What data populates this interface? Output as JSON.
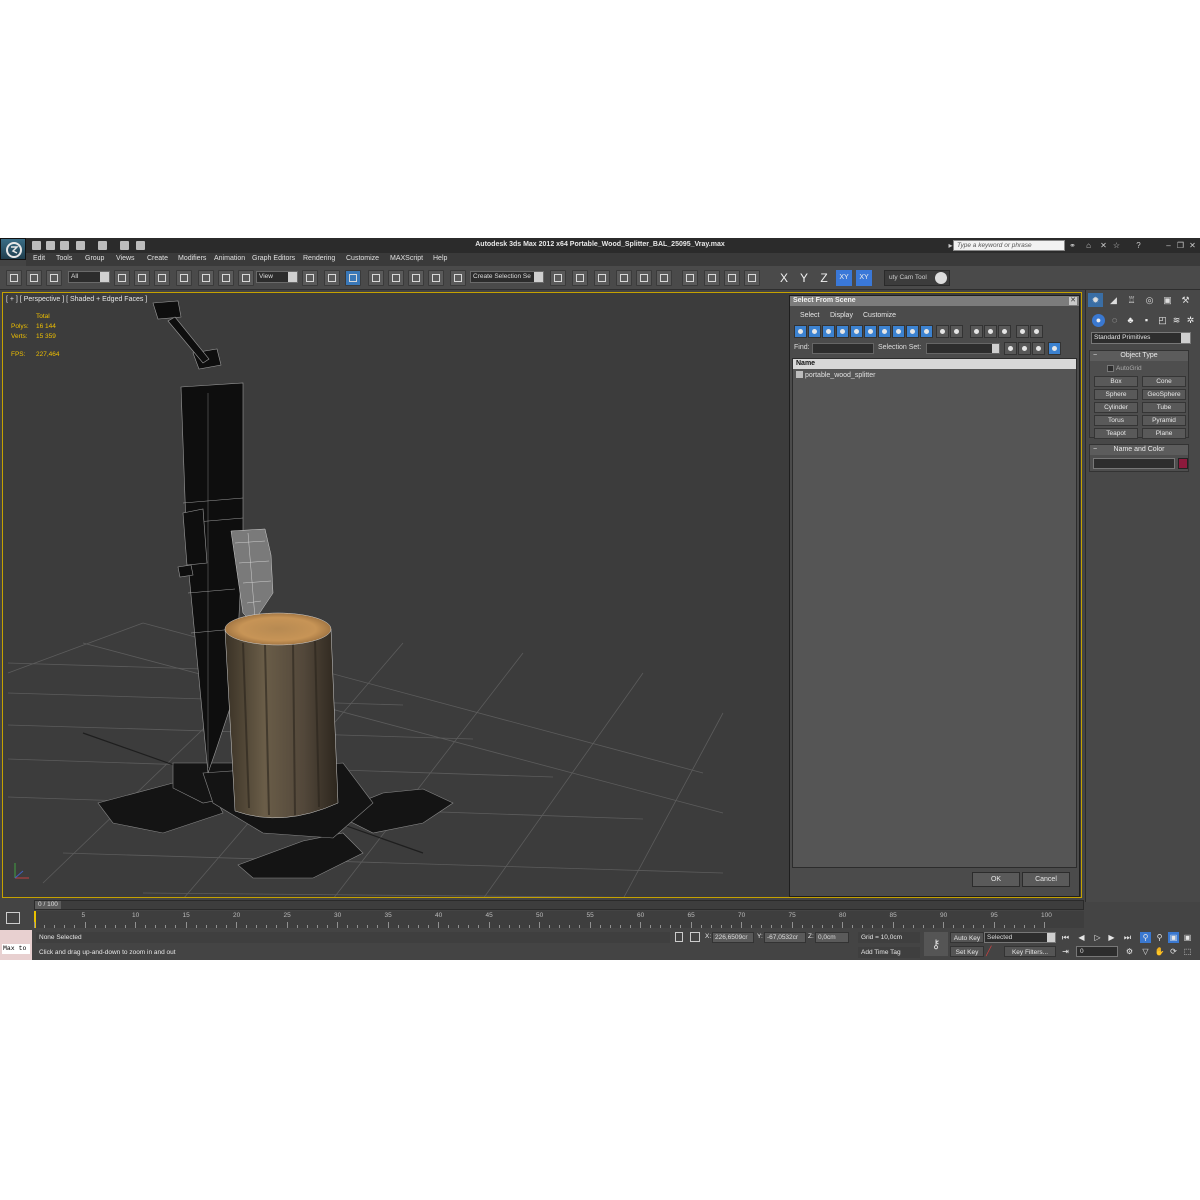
{
  "window": {
    "title": "Autodesk 3ds Max  2012 x64     Portable_Wood_Splitter_BAL_25095_Vray.max",
    "search_placeholder": "Type a keyword or phrase"
  },
  "menu": [
    "Edit",
    "Tools",
    "Group",
    "Views",
    "Create",
    "Modifiers",
    "Animation",
    "Graph Editors",
    "Rendering",
    "Customize",
    "MAXScript",
    "Help"
  ],
  "toolbar": {
    "filter_dropdown": "All",
    "refcoord_dropdown": "View",
    "selection_set_dropdown": "Create Selection Se",
    "axis_x": "X",
    "axis_y": "Y",
    "axis_z": "Z",
    "axis_xy": "XY",
    "axis_xy2": "XY",
    "cam_tool_label": "uty Cam Tool"
  },
  "viewport": {
    "label": "[ + ] [ Perspective ] [ Shaded + Edged Faces ]",
    "stats": {
      "total_label": "Total",
      "polys_label": "Polys:",
      "polys_value": "16 144",
      "verts_label": "Verts:",
      "verts_value": "15 359",
      "fps_label": "FPS:",
      "fps_value": "227,464"
    }
  },
  "select_dialog": {
    "title": "Select From Scene",
    "menus": [
      "Select",
      "Display",
      "Customize"
    ],
    "find_label": "Find:",
    "selection_set_label": "Selection Set:",
    "column_name": "Name",
    "items": [
      "portable_wood_splitter"
    ],
    "ok_label": "OK",
    "cancel_label": "Cancel"
  },
  "command_panel": {
    "category": "Standard Primitives",
    "object_type_title": "Object Type",
    "autogrid_label": "AutoGrid",
    "primitives": [
      "Box",
      "Cone",
      "Sphere",
      "GeoSphere",
      "Cylinder",
      "Tube",
      "Torus",
      "Pyramid",
      "Teapot",
      "Plane"
    ],
    "name_color_title": "Name and Color",
    "swatch_color": "#8c1a3c"
  },
  "timeline": {
    "frame_display": "0 / 100",
    "ticks": [
      "5",
      "10",
      "15",
      "20",
      "25",
      "30",
      "35",
      "40",
      "45",
      "50",
      "55",
      "60",
      "65",
      "70",
      "75",
      "80",
      "85",
      "90",
      "95",
      "100"
    ]
  },
  "status": {
    "maxscript_text": "Max to",
    "selection": "None Selected",
    "prompt": "Click and drag up-and-down to zoom in and out",
    "x_label": "X:",
    "x_value": "226,6509cr",
    "y_label": "Y:",
    "y_value": "-67,0532cr",
    "z_label": "Z:",
    "z_value": "0,0cm",
    "grid": "Grid = 10,0cm",
    "add_time_tag": "Add Time Tag",
    "auto_key": "Auto Key",
    "set_key": "Set Key",
    "key_mode": "Selected",
    "key_filters": "Key Filters...",
    "current_frame": "0"
  }
}
